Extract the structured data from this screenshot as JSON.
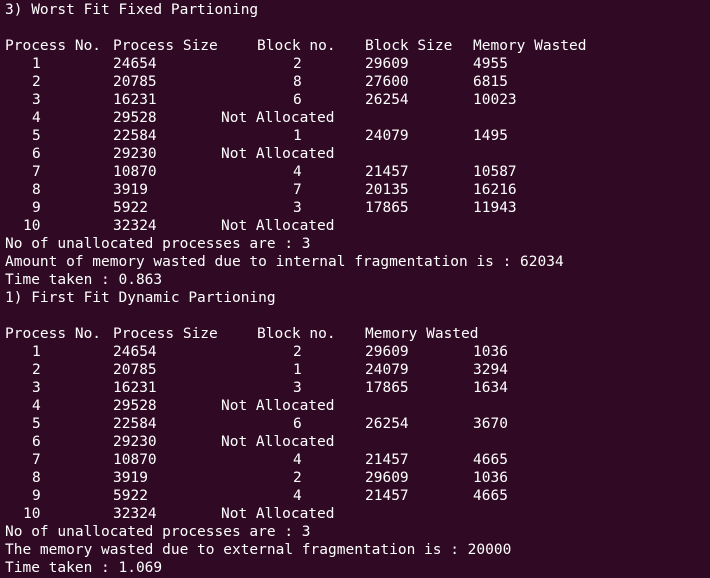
{
  "section1": {
    "title": "3) Worst Fit Fixed Partioning",
    "headers": [
      "Process No.",
      "Process Size",
      "Block no.",
      "Block Size",
      "Memory Wasted"
    ],
    "rows": [
      {
        "no": "1",
        "size": "24654",
        "block": "2",
        "block_size": "29609",
        "wasted": "4955"
      },
      {
        "no": "2",
        "size": "20785",
        "block": "8",
        "block_size": "27600",
        "wasted": "6815"
      },
      {
        "no": "3",
        "size": "16231",
        "block": "6",
        "block_size": "26254",
        "wasted": "10023"
      },
      {
        "no": "4",
        "size": "29528",
        "not_allocated": "Not Allocated"
      },
      {
        "no": "5",
        "size": "22584",
        "block": "1",
        "block_size": "24079",
        "wasted": "1495"
      },
      {
        "no": "6",
        "size": "29230",
        "not_allocated": "Not Allocated"
      },
      {
        "no": "7",
        "size": "10870",
        "block": "4",
        "block_size": "21457",
        "wasted": "10587"
      },
      {
        "no": "8",
        "size": "3919",
        "block": "7",
        "block_size": "20135",
        "wasted": "16216"
      },
      {
        "no": "9",
        "size": "5922",
        "block": "3",
        "block_size": "17865",
        "wasted": "11943"
      },
      {
        "no": "10",
        "size": "32324",
        "not_allocated": "Not Allocated"
      }
    ],
    "summary1": "No of unallocated processes are : 3",
    "summary2": "Amount of memory wasted due to internal fragmentation is : 62034",
    "time": "Time taken : 0.863"
  },
  "section2": {
    "title": "1) First Fit Dynamic Partioning",
    "headers": [
      "Process No.",
      "Process Size",
      "Block no.",
      "Memory Wasted"
    ],
    "rows": [
      {
        "no": "1",
        "size": "24654",
        "block": "2",
        "block_size": "29609",
        "wasted": "1036"
      },
      {
        "no": "2",
        "size": "20785",
        "block": "1",
        "block_size": "24079",
        "wasted": "3294"
      },
      {
        "no": "3",
        "size": "16231",
        "block": "3",
        "block_size": "17865",
        "wasted": "1634"
      },
      {
        "no": "4",
        "size": "29528",
        "not_allocated": "Not Allocated"
      },
      {
        "no": "5",
        "size": "22584",
        "block": "6",
        "block_size": "26254",
        "wasted": "3670"
      },
      {
        "no": "6",
        "size": "29230",
        "not_allocated": "Not Allocated"
      },
      {
        "no": "7",
        "size": "10870",
        "block": "4",
        "block_size": "21457",
        "wasted": "4665"
      },
      {
        "no": "8",
        "size": "3919",
        "block": "2",
        "block_size": "29609",
        "wasted": "1036"
      },
      {
        "no": "9",
        "size": "5922",
        "block": "4",
        "block_size": "21457",
        "wasted": "4665"
      },
      {
        "no": "10",
        "size": "32324",
        "not_allocated": "Not Allocated"
      }
    ],
    "summary1": "No of unallocated processes are : 3",
    "summary2": "The memory wasted due to external fragmentation is : 20000",
    "time": "Time taken : 1.069"
  }
}
